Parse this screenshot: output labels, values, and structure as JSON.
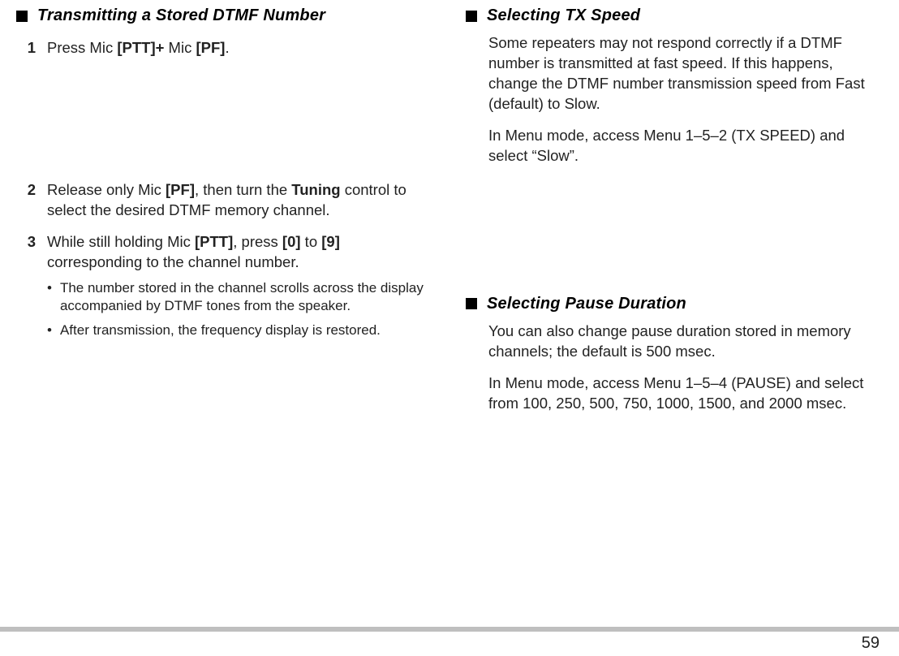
{
  "left": {
    "section1": {
      "heading": "Transmitting a Stored DTMF Number",
      "step1_pre": "Press Mic ",
      "step1_b1": "[PTT]+",
      "step1_mid": " Mic ",
      "step1_b2": "[PF]",
      "step1_end": ".",
      "step2_pre": "Release only Mic ",
      "step2_b1": "[PF]",
      "step2_mid": ", then turn the ",
      "step2_b2": "Tuning",
      "step2_end": " control to select the desired DTMF memory channel.",
      "step3_pre": "While still holding Mic ",
      "step3_b1": "[PTT]",
      "step3_mid": ", press ",
      "step3_b2": "[0]",
      "step3_to": " to ",
      "step3_b3": "[9]",
      "step3_end": " corresponding to the channel number.",
      "bullet1": "The number stored in the channel scrolls across the display accompanied by DTMF tones from the speaker.",
      "bullet2": "After transmission, the frequency display is restored.",
      "num1": "1",
      "num2": "2",
      "num3": "3",
      "dot": "•"
    }
  },
  "right": {
    "tx": {
      "heading": "Selecting TX Speed",
      "p1": "Some repeaters may not respond correctly if a DTMF number is transmitted at fast speed.  If this happens, change the DTMF number transmission speed from Fast (default) to Slow.",
      "p2": "In Menu mode, access Menu 1–5–2 (TX SPEED) and select “Slow”."
    },
    "pause": {
      "heading": "Selecting Pause Duration",
      "p1": "You can also change pause duration stored in memory channels; the default is 500 msec.",
      "p2": "In Menu mode, access Menu 1–5–4 (PAUSE) and select from 100, 250, 500, 750, 1000, 1500, and 2000 msec."
    }
  },
  "page_number": "59"
}
